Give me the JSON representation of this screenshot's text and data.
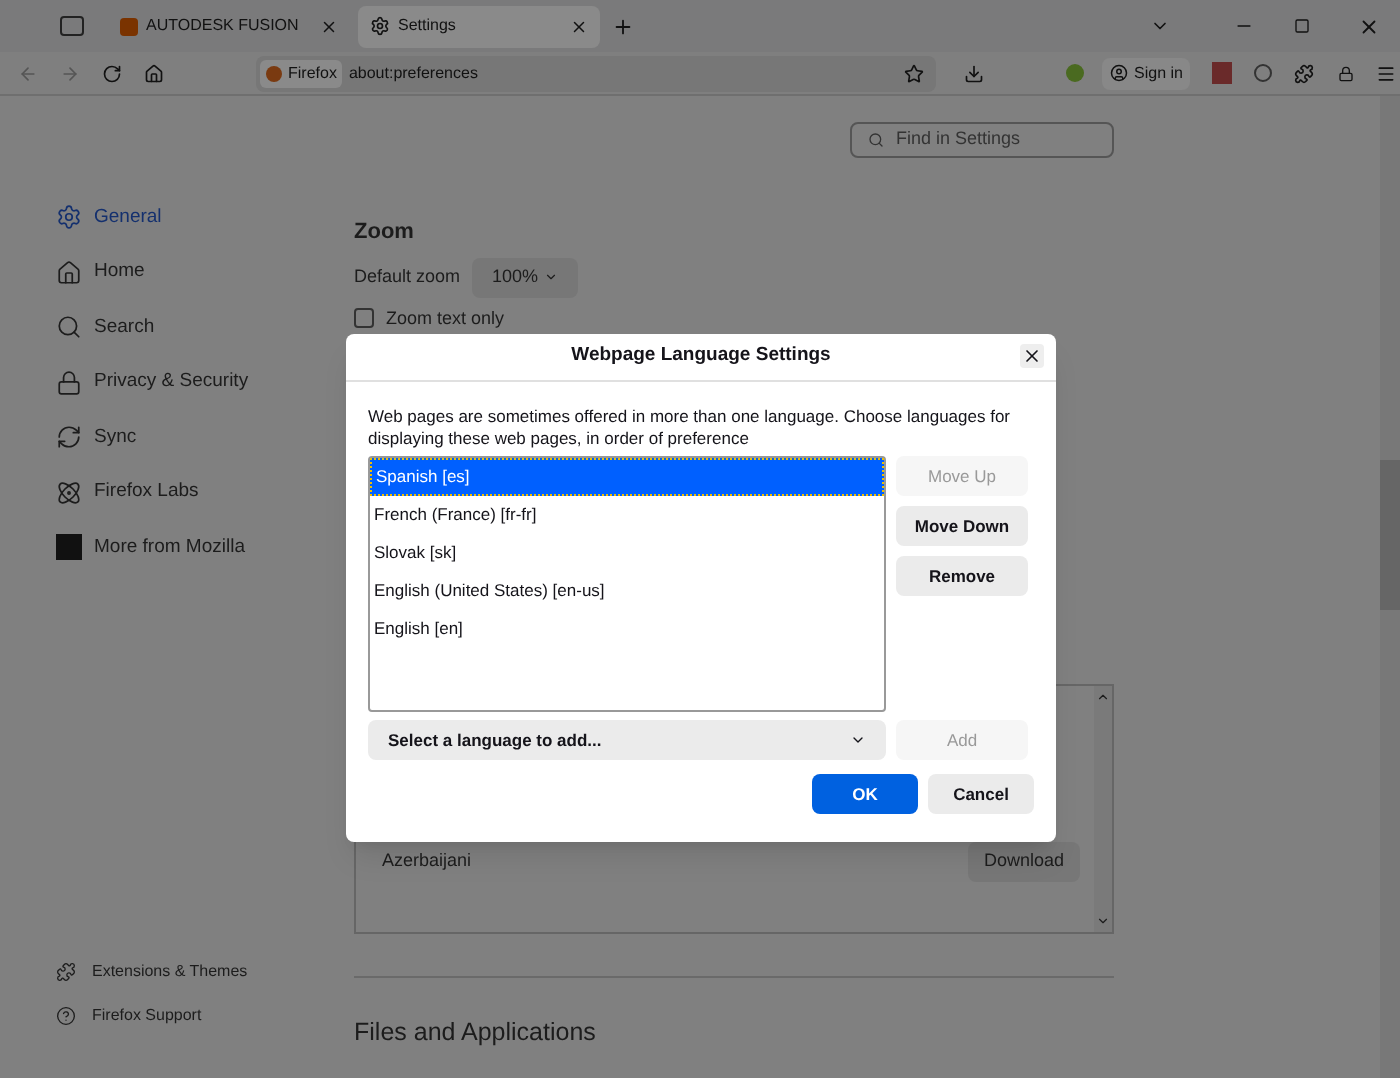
{
  "browser_tabs": [
    {
      "label": "AUTODESK FUSION",
      "kind": "app",
      "selected": false
    },
    {
      "label": "Settings",
      "kind": "settings",
      "selected": true
    }
  ],
  "address_bar": {
    "badge": "Firefox",
    "url": "about:preferences"
  },
  "toolbar": {
    "sign_in": "Sign in"
  },
  "search": {
    "placeholder": "Find in Settings"
  },
  "sidebar": {
    "items": [
      {
        "label": "General",
        "selected": true
      },
      {
        "label": "Home",
        "selected": false
      },
      {
        "label": "Search",
        "selected": false
      },
      {
        "label": "Privacy & Security",
        "selected": false
      },
      {
        "label": "Sync",
        "selected": false
      },
      {
        "label": "Firefox Labs",
        "selected": false
      },
      {
        "label": "More from Mozilla",
        "selected": false
      }
    ],
    "footer": [
      {
        "label": "Extensions & Themes"
      },
      {
        "label": "Firefox Support"
      }
    ]
  },
  "zoom": {
    "heading": "Zoom",
    "default_label": "Default zoom",
    "default_value": "100%",
    "text_only": {
      "label": "Zoom text only",
      "checked": false
    }
  },
  "language_list": [
    {
      "name": "Azerbaijani",
      "action": "Download"
    }
  ],
  "files_heading": "Files and Applications",
  "dialog": {
    "title": "Webpage Language Settings",
    "description": "Web pages are sometimes offered in more than one language. Choose languages for displaying these web pages, in order of preference",
    "languages": [
      {
        "label": "Spanish [es]",
        "selected": true
      },
      {
        "label": "French (France) [fr-fr]",
        "selected": false
      },
      {
        "label": "Slovak [sk]",
        "selected": false
      },
      {
        "label": "English (United States) [en-us]",
        "selected": false
      },
      {
        "label": "English [en]",
        "selected": false
      }
    ],
    "side_buttons": [
      {
        "label": "Move Up",
        "disabled": true
      },
      {
        "label": "Move Down",
        "disabled": false
      },
      {
        "label": "Remove",
        "disabled": false
      }
    ],
    "select_placeholder": "Select a language to add...",
    "add": {
      "label": "Add",
      "disabled": true
    },
    "footer_buttons": [
      {
        "label": "OK",
        "kind": "primary"
      },
      {
        "label": "Cancel",
        "kind": "secondary"
      }
    ]
  }
}
